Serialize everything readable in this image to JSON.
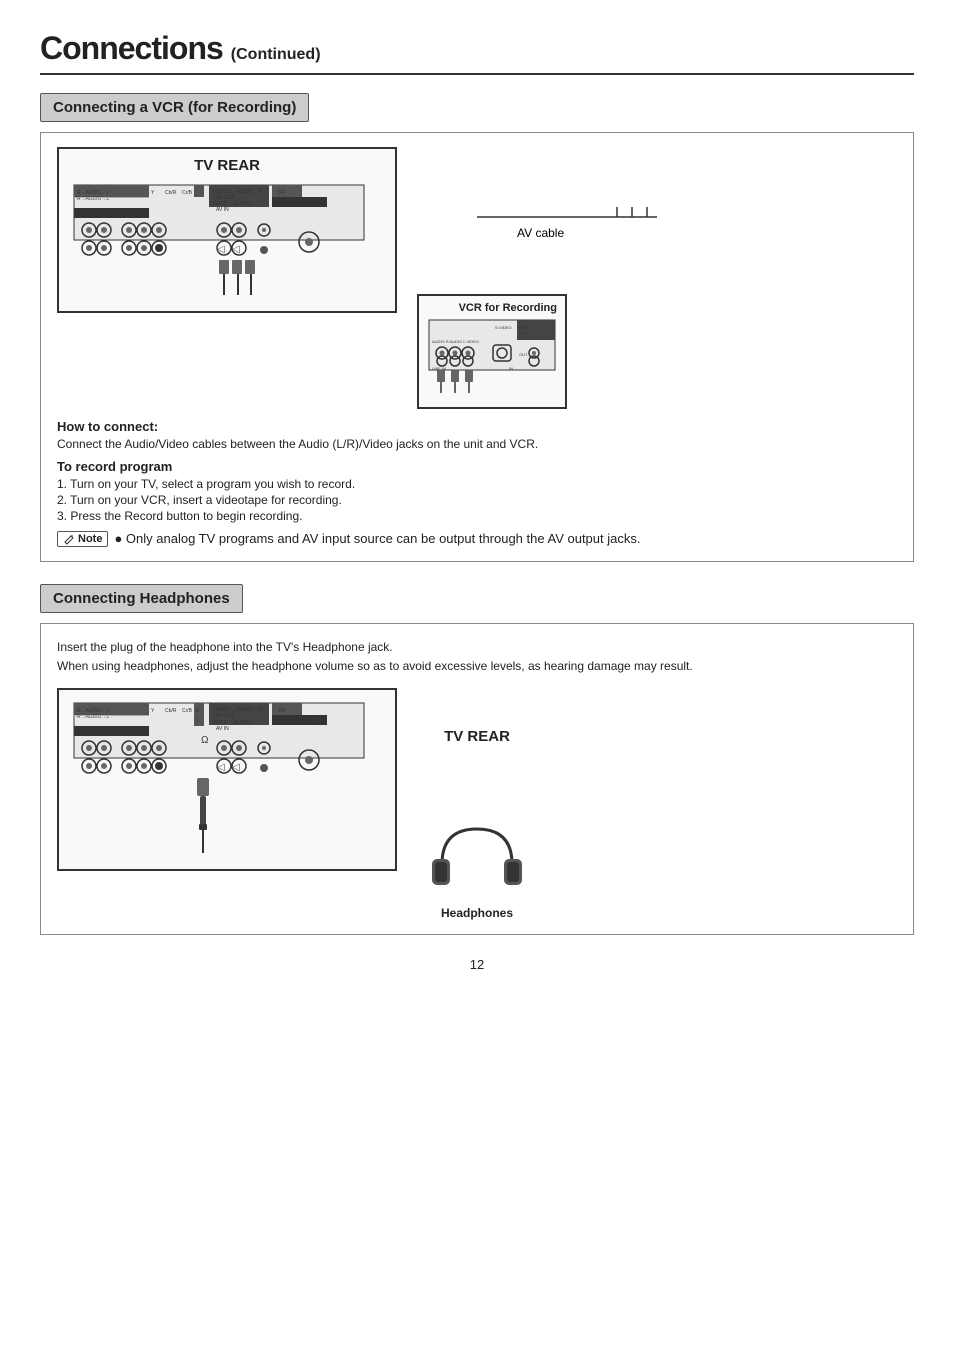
{
  "page": {
    "title_main": "Connections",
    "title_sub": "(Continued)",
    "page_number": "12"
  },
  "vcr_section": {
    "header": "Connecting a VCR (for Recording)",
    "tv_rear_label": "TV REAR",
    "vcr_label": "VCR for Recording",
    "cable_label": "AV cable",
    "how_to_connect_heading": "How to connect:",
    "how_to_connect_text": "Connect the Audio/Video cables between the Audio (L/R)/Video jacks on the unit and VCR.",
    "to_record_heading": "To record program",
    "to_record_steps": [
      "1. Turn on your TV, select a program you wish to record.",
      "2. Turn on your VCR, insert a videotape for recording.",
      "3. Press the Record button to begin recording."
    ],
    "note_label": "Note",
    "note_text": "Only analog TV programs and AV input source can be output through the AV output jacks."
  },
  "headphones_section": {
    "header": "Connecting Headphones",
    "intro_line1": "Insert the plug of the headphone into the TV's Headphone jack.",
    "intro_line2": "When using headphones, adjust the headphone volume so as to avoid excessive levels, as hearing damage may result.",
    "tv_rear_label": "TV REAR",
    "headphones_label": "Headphones"
  }
}
